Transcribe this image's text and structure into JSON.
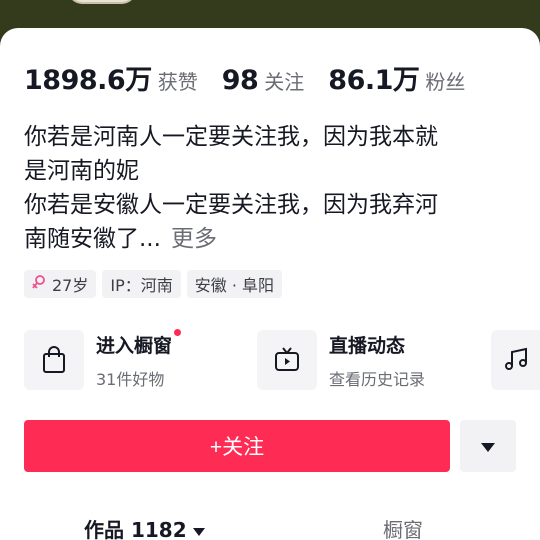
{
  "stats": [
    {
      "value": "1898.6万",
      "label": "获赞"
    },
    {
      "value": "98",
      "label": "关注"
    },
    {
      "value": "86.1万",
      "label": "粉丝"
    }
  ],
  "bio": {
    "line1": "你若是河南人一定要关注我，因为我本就",
    "line2": "是河南的妮",
    "line3": "你若是安徽人一定要关注我，因为我弃河",
    "line4": "南随安徽了...",
    "more": "更多"
  },
  "tags": {
    "age": "27岁",
    "ip": "IP：河南",
    "location": "安徽 · 阜阳"
  },
  "shortcuts": {
    "showcase_title": "进入橱窗",
    "showcase_sub": "31件好物",
    "live_title": "直播动态",
    "live_sub": "查看历史记录"
  },
  "actions": {
    "follow_label": "+关注"
  },
  "tabs": {
    "works": "作品 1182",
    "showcase": "橱窗"
  },
  "colors": {
    "accent": "#fe2c55",
    "female_badge": "#f0508c",
    "header_bg": "#343a1c"
  }
}
